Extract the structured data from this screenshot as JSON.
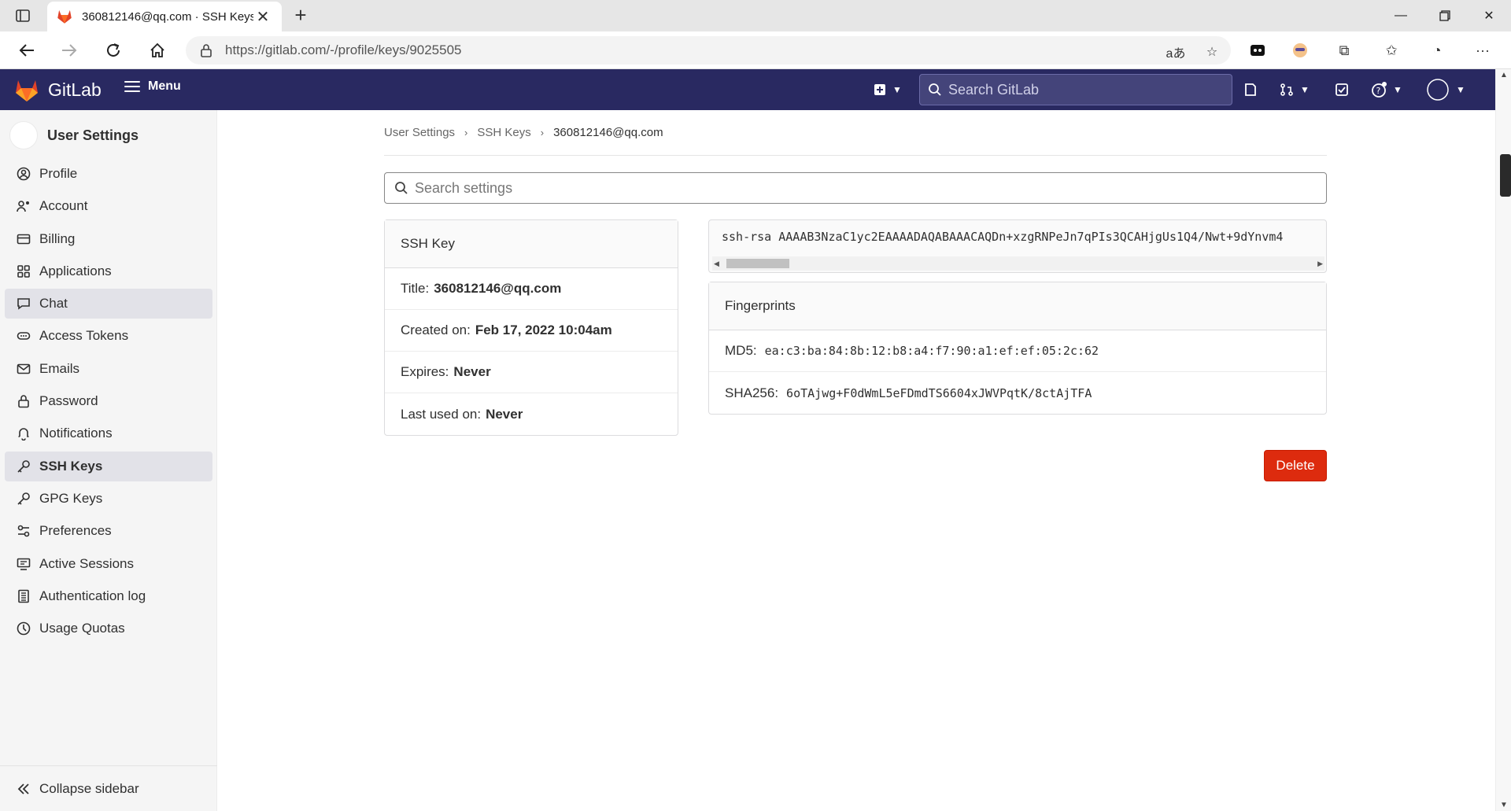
{
  "browser": {
    "tab_title": "360812146@qq.com · SSH Keys",
    "url": "https://gitlab.com/-/profile/keys/9025505"
  },
  "header": {
    "brand": "GitLab",
    "menu_label": "Menu",
    "search_placeholder": "Search GitLab"
  },
  "sidebar": {
    "title": "User Settings",
    "items": [
      {
        "label": "Profile",
        "icon": "profile-icon"
      },
      {
        "label": "Account",
        "icon": "account-icon"
      },
      {
        "label": "Billing",
        "icon": "billing-icon"
      },
      {
        "label": "Applications",
        "icon": "applications-icon"
      },
      {
        "label": "Chat",
        "icon": "chat-icon"
      },
      {
        "label": "Access Tokens",
        "icon": "token-icon"
      },
      {
        "label": "Emails",
        "icon": "mail-icon"
      },
      {
        "label": "Password",
        "icon": "lock-icon"
      },
      {
        "label": "Notifications",
        "icon": "bell-icon"
      },
      {
        "label": "SSH Keys",
        "icon": "key-icon"
      },
      {
        "label": "GPG Keys",
        "icon": "key-icon"
      },
      {
        "label": "Preferences",
        "icon": "preferences-icon"
      },
      {
        "label": "Active Sessions",
        "icon": "monitor-icon"
      },
      {
        "label": "Authentication log",
        "icon": "log-icon"
      },
      {
        "label": "Usage Quotas",
        "icon": "quota-icon"
      }
    ],
    "collapse_label": "Collapse sidebar"
  },
  "breadcrumb": {
    "items": [
      "User Settings",
      "SSH Keys",
      "360812146@qq.com"
    ]
  },
  "settings_search": {
    "placeholder": "Search settings"
  },
  "ssh_key": {
    "heading": "SSH Key",
    "title_label": "Title:",
    "title_value": "360812146@qq.com",
    "created_label": "Created on:",
    "created_value": "Feb 17, 2022 10:04am",
    "expires_label": "Expires:",
    "expires_value": "Never",
    "last_used_label": "Last used on:",
    "last_used_value": "Never",
    "key_text": "ssh-rsa AAAAB3NzaC1yc2EAAAADAQABAAACAQDn+xzgRNPeJn7qPIs3QCAHjgUs1Q4/Nwt+9dYnvm4"
  },
  "fingerprints": {
    "heading": "Fingerprints",
    "md5_label": "MD5:",
    "md5_value": "ea:c3:ba:84:8b:12:b8:a4:f7:90:a1:ef:ef:05:2c:62",
    "sha256_label": "SHA256:",
    "sha256_value": "6oTAjwg+F0dWmL5eFDmdTS6604xJWVPqtK/8ctAjTFA"
  },
  "actions": {
    "delete_label": "Delete"
  },
  "colors": {
    "header_bg": "#292961",
    "delete_bg": "#dd2b0e",
    "sidebar_bg": "#f5f5f5"
  }
}
